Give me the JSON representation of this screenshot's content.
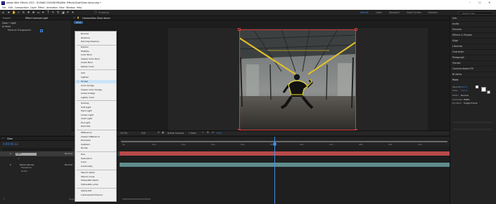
{
  "window": {
    "title": "Adobe After Effects 2022 - D:\\RAW\\ 2020\\WORK\\After Effects\\Glow\\Glow dance.aep *",
    "app_logo": "Ae",
    "controls": [
      "–",
      "☐",
      "✕"
    ]
  },
  "menubar": [
    "File",
    "Edit",
    "Composition",
    "Layer",
    "Effect",
    "Animation",
    "View",
    "Window",
    "Help"
  ],
  "toolbar": {
    "snapping_label": "Snapping",
    "workspaces": [
      "Default",
      "Learn",
      "Standard",
      "Small Screen",
      "Libraries"
    ],
    "search_placeholder": "Search Help"
  },
  "effect_panel": {
    "tabs": [
      "Project",
      "Effect Controls Light"
    ],
    "header": "Glow • Light",
    "rows": [
      "fx  Paint",
      "Paint on Transparent"
    ],
    "checkbox_checked": true
  },
  "comp_panel": {
    "tab": "Composition Glow dance",
    "breadcrumb": "Glow"
  },
  "viewer_bar": {
    "zoom": "33.3%",
    "resolution": "Full",
    "camera": "Active Camera",
    "views": "1 View",
    "exposure": "+0.0"
  },
  "blend_menu": {
    "groups": [
      [
        "Normal",
        "Dissolve",
        "Dancing Dissolve"
      ],
      [
        "Darken",
        "Multiply",
        "Color Burn",
        "Classic Color Burn",
        "Linear Burn",
        "Darker Color"
      ],
      [
        "Add",
        "Lighten",
        "Screen",
        "Color Dodge",
        "Classic Color Dodge",
        "Linear Dodge",
        "Lighter Color"
      ],
      [
        "Overlay",
        "Soft Light",
        "Hard Light",
        "Linear Light",
        "Vivid Light",
        "Pin Light",
        "Hard Mix"
      ],
      [
        "Difference",
        "Classic Difference",
        "Exclusion",
        "Subtract",
        "Divide"
      ],
      [
        "Hue",
        "Saturation",
        "Color",
        "Luminosity"
      ],
      [
        "Stencil Alpha",
        "Stencil Luma",
        "Silhouette Alpha",
        "Silhouette Luma"
      ],
      [
        "Alpha Add",
        "Luminescent Premul"
      ]
    ],
    "selected": "Screen"
  },
  "right_panel": {
    "sections": [
      "Info",
      "Audio",
      "Preview",
      "Effects & Presets",
      "Align",
      "Libraries",
      "Character",
      "Paragraph",
      "Tracker",
      "Content-Aware Fill",
      "Brushes",
      "Paint"
    ],
    "paint": {
      "opacity_label": "Opacity:",
      "opacity": "100 %",
      "flow_label": "Flow:",
      "flow": "100 %",
      "mode_label": "Mode:",
      "mode": "Normal",
      "channels_label": "Channels:",
      "channels": "RGBA",
      "duration_label": "Duration:",
      "duration": "Single Frame"
    }
  },
  "timeline": {
    "tab": "Glow",
    "timecode": "0:00:05:12",
    "layers": [
      {
        "num": "1",
        "name": "Light",
        "mode": "Normal"
      },
      {
        "num": "2",
        "name": "[Glow dance]",
        "mode": "Normal"
      }
    ],
    "sublayers": [
      "Transform",
      "Audio"
    ],
    "ruler": [
      "0s",
      "01s",
      "02s",
      "03s",
      "04s",
      "05s",
      "06s",
      "07s",
      "08s",
      "09s",
      "10s"
    ],
    "footer": "Toggle Switches / Modes"
  },
  "colors": {
    "accent": "#3f8ee8",
    "playhead": "#3f8ee8",
    "mask": "#f5e11e",
    "track_red": "#b84a4a",
    "track_teal": "#5f8d8d"
  }
}
